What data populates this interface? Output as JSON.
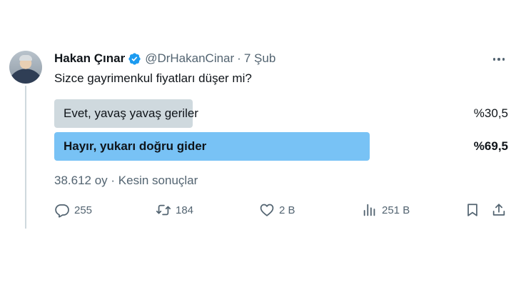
{
  "tweet": {
    "author_name": "Hakan Çınar",
    "handle": "@DrHakanCinar",
    "separator": "·",
    "date": "7 Şub",
    "text": "Sizce gayrimenkul fiyatları düşer mi?"
  },
  "poll": {
    "options": [
      {
        "label": "Evet, yavaş yavaş geriler",
        "percent_text": "%30,5",
        "percent": 30.5,
        "winner": false
      },
      {
        "label": "Hayır, yukarı doğru gider",
        "percent_text": "%69,5",
        "percent": 69.5,
        "winner": true
      }
    ],
    "meta": "38.612 oy · Kesin sonuçlar"
  },
  "actions": {
    "replies": "255",
    "retweets": "184",
    "likes": "2 B",
    "views": "251 B"
  },
  "colors": {
    "winner_bar": "#78c2f5",
    "other_bar": "#cfd9de",
    "verified": "#1d9bf0",
    "muted_text": "#536471"
  },
  "icons": [
    "verified-badge-icon",
    "more-icon",
    "reply-icon",
    "retweet-icon",
    "like-icon",
    "views-icon",
    "bookmark-icon",
    "share-icon"
  ]
}
